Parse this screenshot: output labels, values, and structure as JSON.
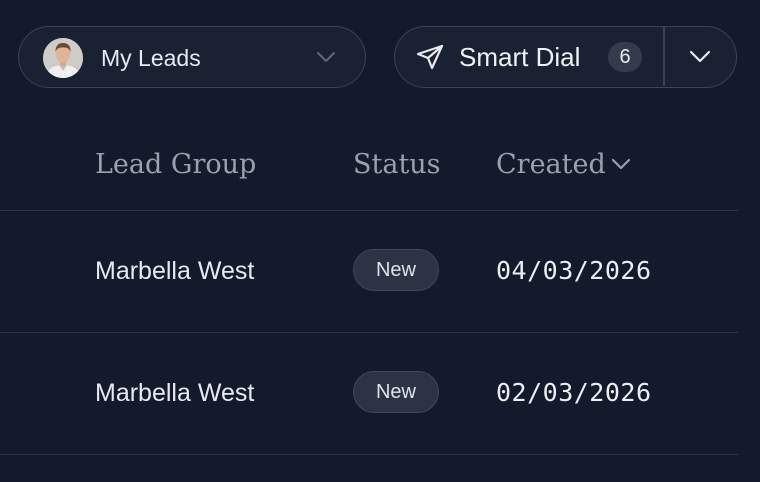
{
  "toolbar": {
    "lead_selector": {
      "label": "My Leads",
      "avatar_icon": "user-avatar-photo",
      "chevron_icon": "chevron-down-icon"
    },
    "smart_dial": {
      "label": "Smart Dial",
      "count": "6",
      "icon": "send-icon",
      "dropdown_icon": "chevron-down-icon"
    }
  },
  "table": {
    "columns": [
      {
        "label": "Lead Group"
      },
      {
        "label": "Status"
      },
      {
        "label": "Created",
        "sort_icon": "chevron-down-icon"
      }
    ],
    "rows": [
      {
        "lead_group": "Marbella West",
        "status": "New",
        "created": "04/03/2026"
      },
      {
        "lead_group": "Marbella West",
        "status": "New",
        "created": "02/03/2026"
      }
    ]
  },
  "colors": {
    "background": "#131a2c",
    "surface": "#1a2133",
    "border": "#3a4256",
    "badge": "#2c3344",
    "header_text": "#9aa0ad"
  }
}
